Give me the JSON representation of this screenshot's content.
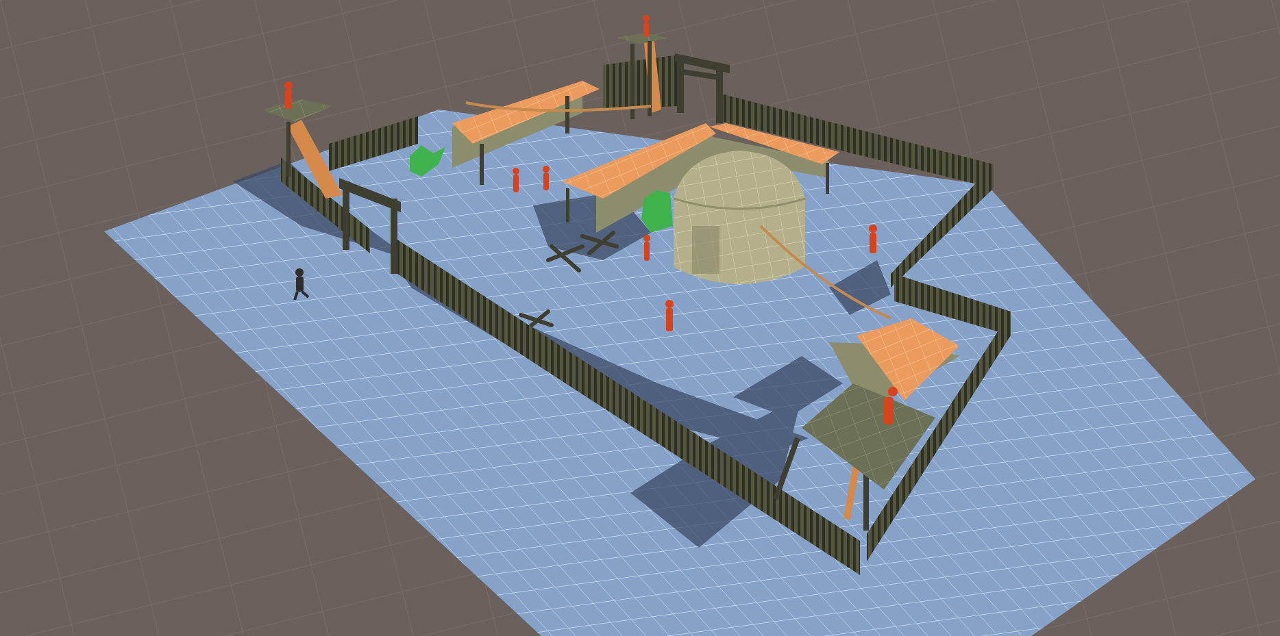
{
  "scene": {
    "colors": {
      "background": "#6b615c",
      "background_grid": "#766c66",
      "ground": "#87a2c8",
      "ground_grid": "#c2d5ee",
      "ground_shadow": "#3d4b66",
      "fence": "#3e3f30",
      "fence_light": "#55563f",
      "roof": "#e8945a",
      "roof_dark": "#c9773f",
      "wall": "#8c8d6c",
      "yurt": "#b5b38e",
      "yurt_dark": "#8f8d6b",
      "platform": "#6e7256",
      "ladder": "#d58a4c",
      "grass": "#3fb24d",
      "enemy": "#d8431d",
      "player": "#2e2c2c",
      "rope": "#c58a4e"
    }
  }
}
